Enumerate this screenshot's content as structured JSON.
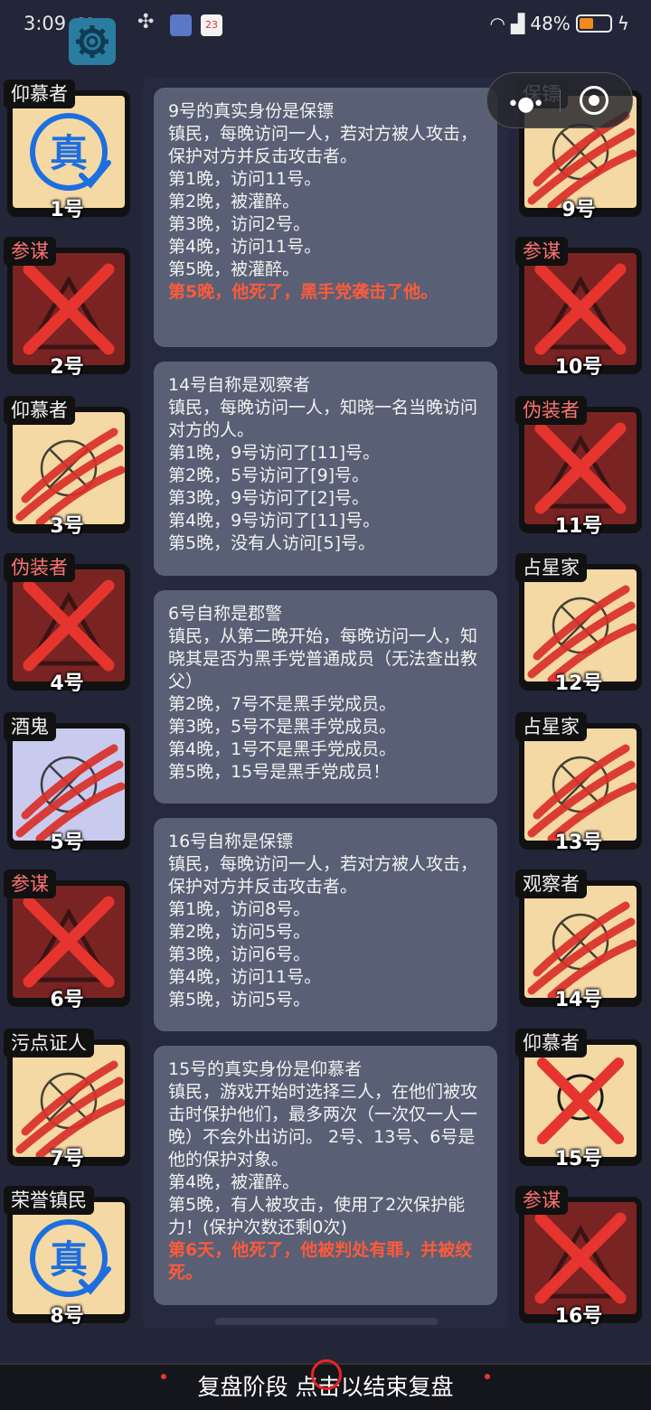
{
  "status_bar": {
    "time": "3:09",
    "network": "60",
    "notif_badge": "23",
    "battery_text": "48%",
    "battery_level": 0.48
  },
  "left_players": [
    {
      "role": "仰慕者",
      "number": "1号",
      "state": "verified",
      "role_color": "white"
    },
    {
      "role": "参谋",
      "number": "2号",
      "state": "dead",
      "role_color": "red"
    },
    {
      "role": "仰慕者",
      "number": "3号",
      "state": "killed",
      "role_color": "white"
    },
    {
      "role": "伪装者",
      "number": "4号",
      "state": "dead",
      "role_color": "red"
    },
    {
      "role": "酒鬼",
      "number": "5号",
      "state": "killed-purple",
      "role_color": "white"
    },
    {
      "role": "参谋",
      "number": "6号",
      "state": "dead",
      "role_color": "red"
    },
    {
      "role": "污点证人",
      "number": "7号",
      "state": "killed",
      "role_color": "white"
    },
    {
      "role": "荣誉镇民",
      "number": "8号",
      "state": "verified",
      "role_color": "white"
    }
  ],
  "right_players": [
    {
      "role": "保镖",
      "number": "9号",
      "state": "killed",
      "role_color": "white"
    },
    {
      "role": "参谋",
      "number": "10号",
      "state": "dead",
      "role_color": "red"
    },
    {
      "role": "伪装者",
      "number": "11号",
      "state": "dead",
      "role_color": "red"
    },
    {
      "role": "占星家",
      "number": "12号",
      "state": "killed",
      "role_color": "white"
    },
    {
      "role": "占星家",
      "number": "13号",
      "state": "killed",
      "role_color": "white"
    },
    {
      "role": "观察者",
      "number": "14号",
      "state": "killed",
      "role_color": "white"
    },
    {
      "role": "仰慕者",
      "number": "15号",
      "state": "crossed",
      "role_color": "white"
    },
    {
      "role": "参谋",
      "number": "16号",
      "state": "dead",
      "role_color": "red"
    }
  ],
  "verified_mark": "真",
  "messages": [
    {
      "lines": [
        "9号的真实身份是保镖",
        "镇民，每晚访问一人，若对方被人攻击，保护对方并反击攻击者。",
        "第1晚，访问11号。",
        "第2晚，被灌醉。",
        "第3晚，访问2号。",
        "第4晚，访问11号。",
        "第5晚，被灌醉。"
      ],
      "highlight": "第5晚，他死了，黑手党袭击了他。"
    },
    {
      "lines": [
        "14号自称是观察者",
        "镇民，每晚访问一人，知晓一名当晚访问对方的人。",
        "第1晚，9号访问了[11]号。",
        "第2晚，5号访问了[9]号。",
        "第3晚，9号访问了[2]号。",
        "第4晚，9号访问了[11]号。",
        "第5晚，没有人访问[5]号。"
      ],
      "highlight": ""
    },
    {
      "lines": [
        "6号自称是郡警",
        "镇民，从第二晚开始，每晚访问一人，知晓其是否为黑手党普通成员（无法查出教父）",
        "第2晚，7号不是黑手党成员。",
        "第3晚，5号不是黑手党成员。",
        "第4晚，1号不是黑手党成员。",
        "第5晚，15号是黑手党成员！"
      ],
      "highlight": ""
    },
    {
      "lines": [
        "16号自称是保镖",
        "镇民，每晚访问一人，若对方被人攻击，保护对方并反击攻击者。",
        "第1晚，访问8号。",
        "第2晚，访问5号。",
        "第3晚，访问6号。",
        "第4晚，访问11号。",
        "第5晚，访问5号。"
      ],
      "highlight": ""
    },
    {
      "lines": [
        "15号的真实身份是仰慕者",
        "镇民，游戏开始时选择三人，在他们被攻击时保护他们，最多两次（一次仅一人一晚）不会外出访问。 2号、13号、6号是他的保护对象。",
        "第4晚，被灌醉。",
        "第5晚，有人被攻击，使用了2次保护能力！(保护次数还剩0次)"
      ],
      "highlight": "第6天，他死了，他被判处有罪，并被绞死。"
    }
  ],
  "bottom_bar": {
    "label": "复盘阶段 点击以结束复盘"
  },
  "colors": {
    "background": "#232638",
    "message_bg": "#596075",
    "highlight": "#ff5a3a",
    "role_red": "#ff7272",
    "card_light": "#f4d9a4",
    "card_dead": "#7a2323",
    "card_purple": "#c9cbee"
  }
}
